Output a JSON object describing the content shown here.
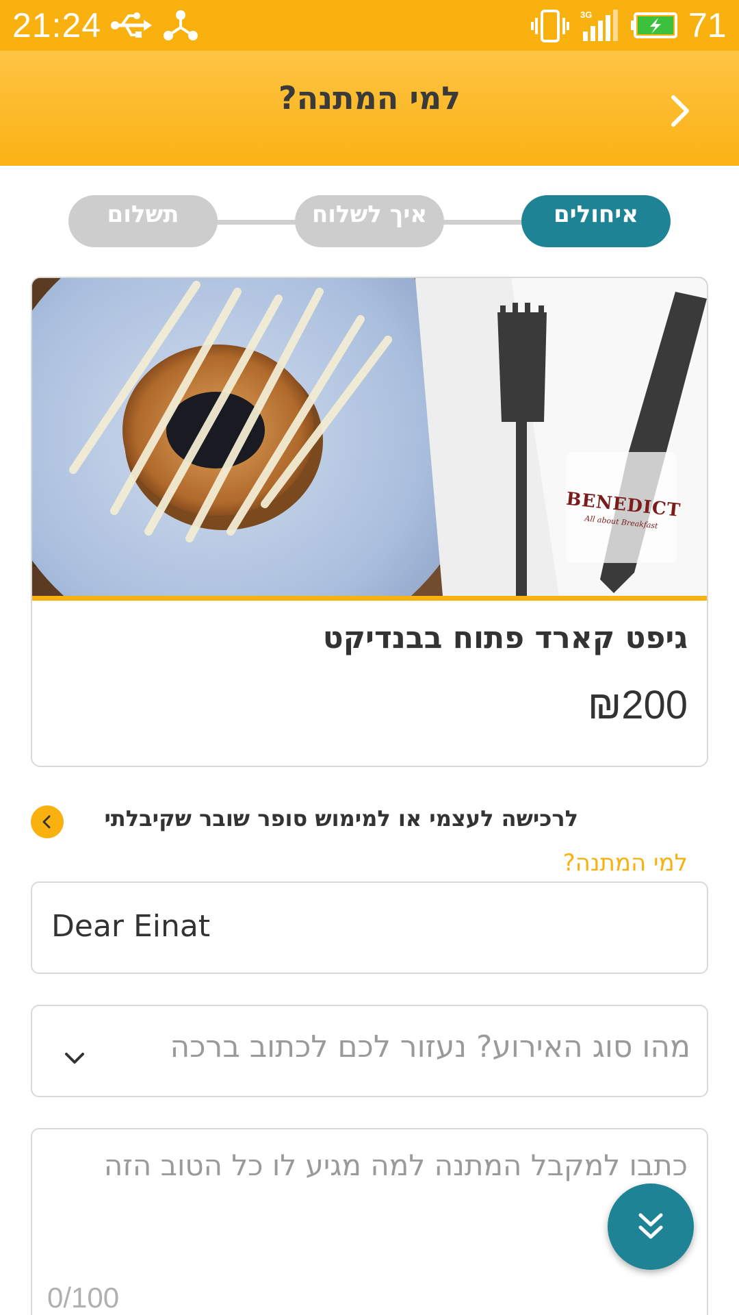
{
  "status_bar": {
    "time": "21:24",
    "battery_percent": "71",
    "signal_type": "3G",
    "icons": [
      "usb-icon",
      "share-icon",
      "vibrate-icon",
      "signal-icon",
      "battery-charging-icon"
    ]
  },
  "header": {
    "title": "למי המתנה?",
    "back_icon": "chevron-right-icon"
  },
  "stepper": {
    "steps": [
      {
        "label": "איחולים",
        "active": true
      },
      {
        "label": "איך לשלוח",
        "active": false
      },
      {
        "label": "תשלום",
        "active": false
      }
    ]
  },
  "card": {
    "title": "גיפט קארד פתוח בבנדיקט",
    "price": "₪200",
    "logo": {
      "name": "BENEDICT",
      "tagline": "All about Breakfast"
    }
  },
  "self_purchase": {
    "label": "לרכישה לעצמי או למימוש סופר שובר שקיבלתי"
  },
  "form": {
    "recipient_label": "למי המתנה?",
    "recipient_value": "Dear Einat",
    "event_placeholder": "מהו סוג האירוע? נעזור לכם לכתוב ברכה",
    "message_placeholder": "כתבו למקבל המתנה למה מגיע לו כל הטוב הזה",
    "char_counter": "0/100"
  },
  "colors": {
    "accent": "#F8B10F",
    "primary": "#1E8394",
    "inactive_step": "#CDCDCD"
  }
}
